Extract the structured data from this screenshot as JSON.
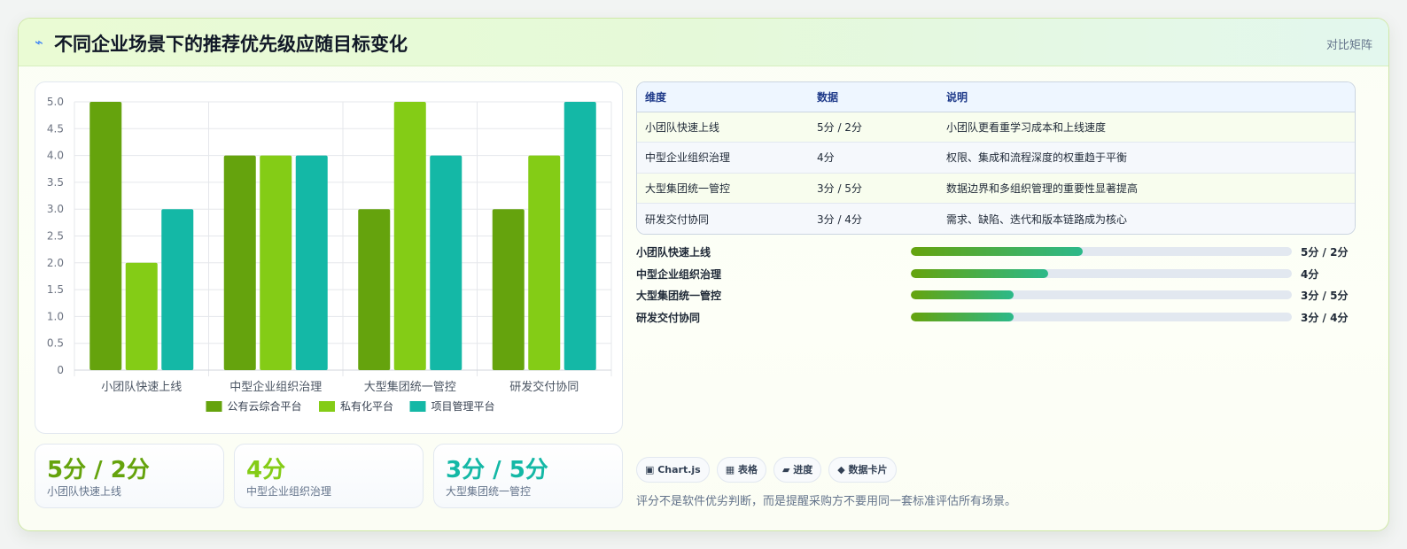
{
  "header": {
    "icon": "bolt-icon",
    "title": "不同企业场景下的推荐优先级应随目标变化",
    "badge": "对比矩阵"
  },
  "chart_data": {
    "type": "bar",
    "categories": [
      "小团队快速上线",
      "中型企业组织治理",
      "大型集团统一管控",
      "研发交付协同"
    ],
    "series": [
      {
        "name": "公有云综合平台",
        "values": [
          5,
          4,
          3,
          3
        ],
        "color": "#65a30d"
      },
      {
        "name": "私有化平台",
        "values": [
          2,
          4,
          5,
          4
        ],
        "color": "#84cc16"
      },
      {
        "name": "项目管理平台",
        "values": [
          3,
          4,
          4,
          5
        ],
        "color": "#14b8a6"
      }
    ],
    "y_ticks": [
      "0",
      "0.5",
      "1.0",
      "1.5",
      "2.0",
      "2.5",
      "3.0",
      "3.5",
      "4.0",
      "4.5",
      "5.0"
    ],
    "ylim": [
      0,
      5
    ],
    "grid": true,
    "legend_position": "bottom"
  },
  "kpis": [
    {
      "value": "5分 / 2分",
      "label": "小团队快速上线",
      "color": "#65a30d"
    },
    {
      "value": "4分",
      "label": "中型企业组织治理",
      "color": "#84cc16"
    },
    {
      "value": "3分 / 5分",
      "label": "大型集团统一管控",
      "color": "#14b8a6"
    }
  ],
  "table": {
    "headers": [
      "维度",
      "数据",
      "说明"
    ],
    "rows": [
      [
        "小团队快速上线",
        "5分 / 2分",
        "小团队更看重学习成本和上线速度"
      ],
      [
        "中型企业组织治理",
        "4分",
        "权限、集成和流程深度的权重趋于平衡"
      ],
      [
        "大型集团统一管控",
        "3分 / 5分",
        "数据边界和多组织管理的重要性显著提高"
      ],
      [
        "研发交付协同",
        "3分 / 4分",
        "需求、缺陷、迭代和版本链路成为核心"
      ]
    ]
  },
  "progress": [
    {
      "label": "小团队快速上线",
      "value_text": "5分 / 2分",
      "fraction": 0.45
    },
    {
      "label": "中型企业组织治理",
      "value_text": "4分",
      "fraction": 0.36
    },
    {
      "label": "大型集团统一管控",
      "value_text": "3分 / 5分",
      "fraction": 0.27
    },
    {
      "label": "研发交付协同",
      "value_text": "3分 / 4分",
      "fraction": 0.27
    }
  ],
  "tags": [
    {
      "icon": "chart-icon",
      "label": "▣ Chart.js"
    },
    {
      "icon": "table-icon",
      "label": "▦ 表格"
    },
    {
      "icon": "progress-icon",
      "label": "▰ 进度"
    },
    {
      "icon": "card-icon",
      "label": "◆ 数据卡片"
    }
  ],
  "footnote": "评分不是软件优劣判断，而是提醒采购方不要用同一套标准评估所有场景。"
}
